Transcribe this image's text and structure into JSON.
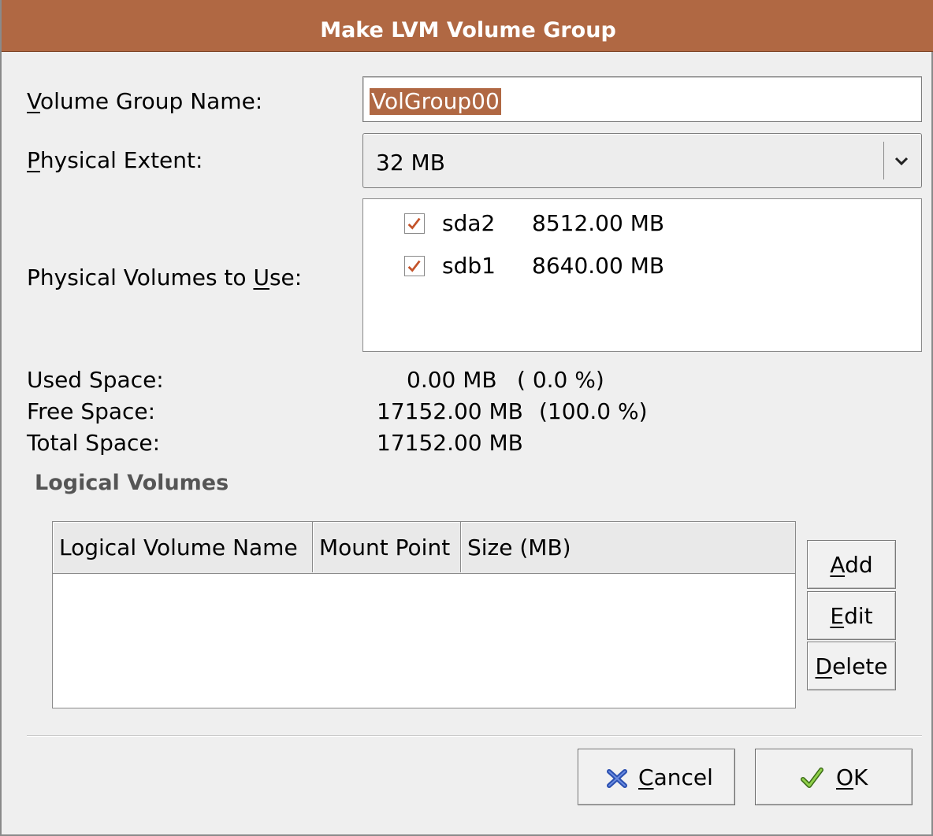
{
  "dialog": {
    "title": "Make LVM Volume Group"
  },
  "form": {
    "vg_name": {
      "label_mnemonic": "V",
      "label_rest": "olume Group Name:",
      "value": "VolGroup00"
    },
    "physical_extent": {
      "label_mnemonic": "P",
      "label_rest": "hysical Extent:",
      "value": "32 MB"
    },
    "physical_volumes": {
      "label_pre": "Physical Volumes to ",
      "label_mnemonic": "U",
      "label_post": "se:",
      "items": [
        {
          "name": "sda2",
          "size": "8512.00 MB",
          "checked": true
        },
        {
          "name": "sdb1",
          "size": "8640.00 MB",
          "checked": true
        }
      ]
    }
  },
  "space": {
    "used_label": "Used Space:",
    "used_value": "0.00 MB",
    "used_pct": "( 0.0 %)",
    "free_label": "Free Space:",
    "free_value": "17152.00 MB",
    "free_pct": "(100.0 %)",
    "total_label": "Total Space:",
    "total_value": "17152.00 MB"
  },
  "logical_volumes": {
    "frame_title": "Logical Volumes",
    "columns": [
      "Logical Volume Name",
      "Mount Point",
      "Size (MB)"
    ],
    "rows": [],
    "buttons": {
      "add_mnemonic": "A",
      "add_rest": "dd",
      "edit_mnemonic": "E",
      "edit_rest": "dit",
      "delete_mnemonic": "D",
      "delete_rest": "elete"
    }
  },
  "actions": {
    "cancel_mnemonic": "C",
    "cancel_rest": "ancel",
    "ok_mnemonic": "O",
    "ok_rest": "K"
  },
  "colors": {
    "accent": "#b06843",
    "check": "#c4532a",
    "cancel_icon": "#2a4fb0",
    "ok_icon": "#6fb432"
  }
}
